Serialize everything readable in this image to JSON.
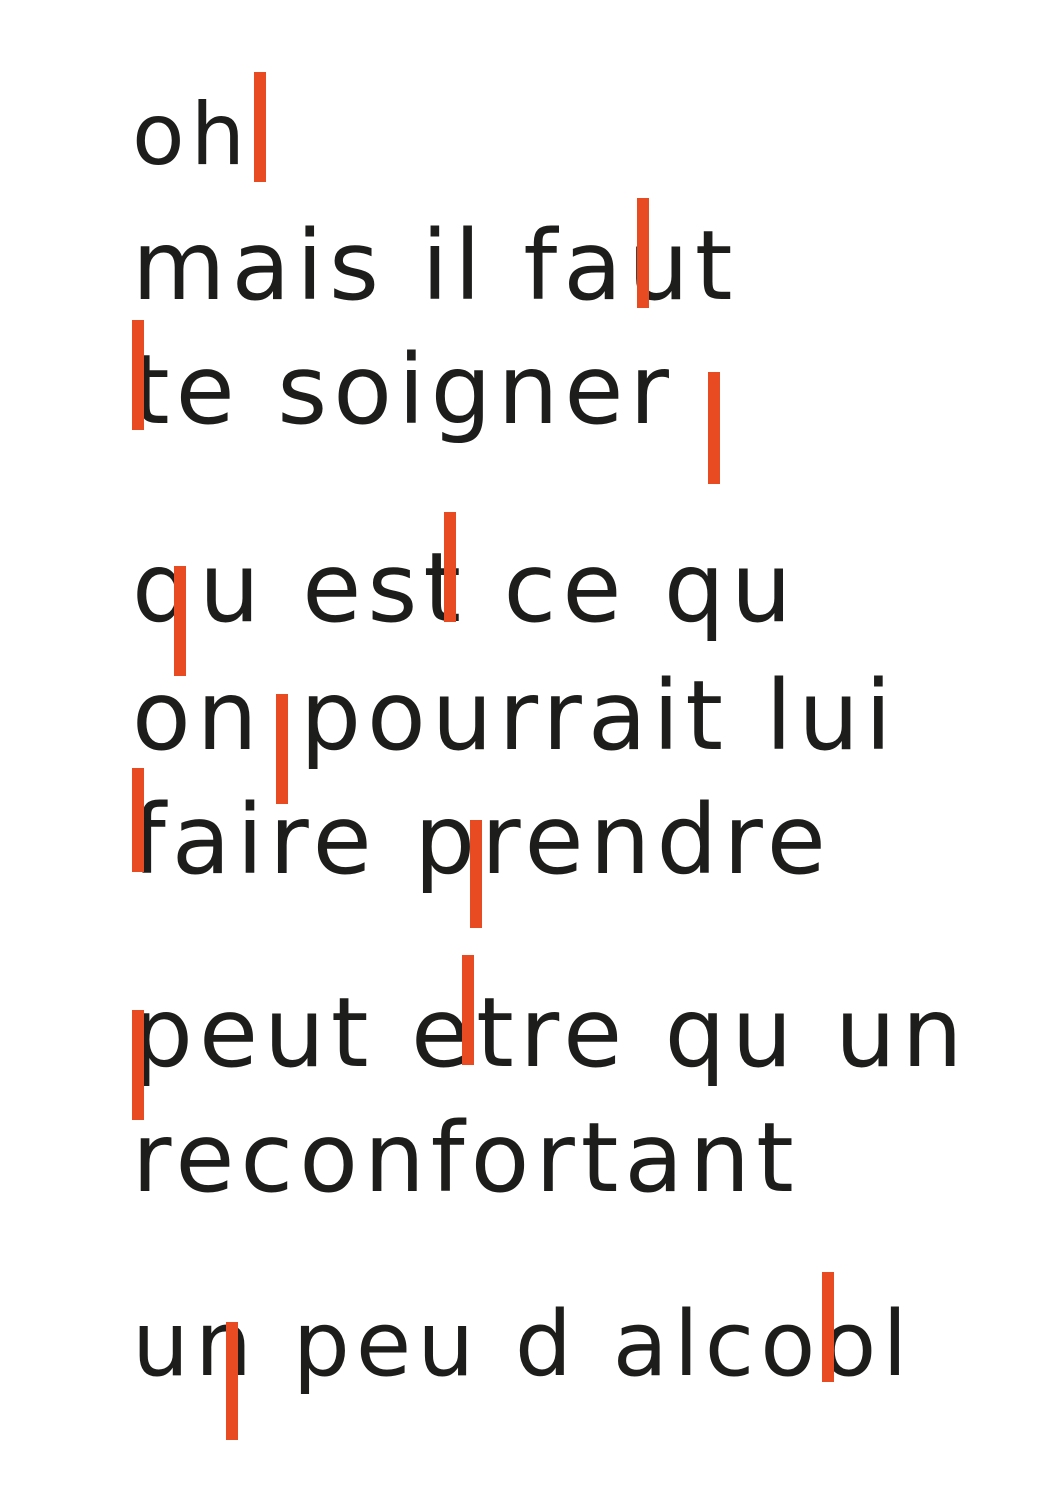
{
  "poem": {
    "stanza1": {
      "line1": "oh"
    },
    "stanza2": {
      "line1": "mais il faut",
      "line2": "te soigner"
    },
    "stanza3": {
      "line1": "qu est ce qu",
      "line2": "on pourrait lui",
      "line3": "faire prendre"
    },
    "stanza4": {
      "line1": "peut etre qu un",
      "line2": "reconfortant"
    },
    "stanza5": {
      "line1": "un peu d alcool"
    }
  },
  "colors": {
    "ink": "#1d1d1b",
    "accent": "#e84a22",
    "background": "#ffffff"
  }
}
